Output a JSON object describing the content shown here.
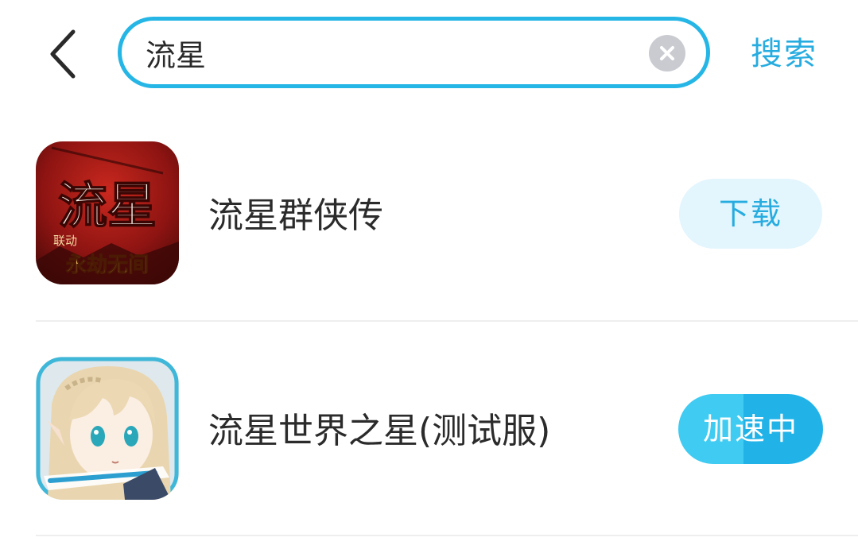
{
  "search": {
    "query": "流星",
    "submit_label": "搜索"
  },
  "results": [
    {
      "name": "流星群侠传",
      "action_label": "下载",
      "icon": "meteor-wuxia-game-icon",
      "icon_text_main": "流星",
      "icon_text_tag": "联动",
      "icon_text_sub": "永劫无间"
    },
    {
      "name": "流星世界之星(测试服)",
      "action_label": "加速中",
      "icon": "anime-character-game-icon"
    }
  ],
  "colors": {
    "accent": "#27ace0",
    "search_border": "#25b6e6",
    "download_bg": "#e3f5fd",
    "accelerating_bg": "#21b3e8",
    "divider": "#eeeeee"
  }
}
